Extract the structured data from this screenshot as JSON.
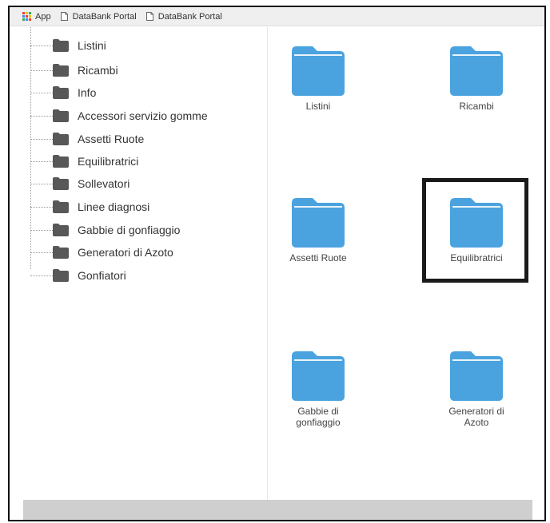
{
  "bookmarks_bar": {
    "apps_label": "App",
    "items": [
      {
        "label": "DataBank Portal"
      },
      {
        "label": "DataBank Portal"
      }
    ],
    "apps_colors": [
      "#ea4335",
      "#fbbc05",
      "#34a853",
      "#4285f4",
      "#ea4335",
      "#fbbc05",
      "#34a853",
      "#4285f4",
      "#ea4335"
    ]
  },
  "tree": {
    "items": [
      {
        "label": "Listini"
      },
      {
        "label": "Ricambi"
      },
      {
        "label": "Info"
      },
      {
        "label": "Accessori servizio gomme"
      },
      {
        "label": "Assetti Ruote"
      },
      {
        "label": "Equilibratrici"
      },
      {
        "label": "Sollevatori"
      },
      {
        "label": "Linee diagnosi"
      },
      {
        "label": "Gabbie di gonfiaggio"
      },
      {
        "label": "Generatori di Azoto"
      },
      {
        "label": "Gonfiatori"
      }
    ]
  },
  "grid": {
    "tiles": [
      {
        "label": "Listini"
      },
      {
        "label": "Ricambi"
      },
      {
        "label": "Assetti Ruote"
      },
      {
        "label": "Equilibratrici",
        "highlighted": true
      },
      {
        "label": "Gabbie di gonfiaggio"
      },
      {
        "label": "Generatori di Azoto"
      }
    ]
  },
  "colors": {
    "folder_blue": "#4aa3df",
    "folder_blue_dark": "#3b8fcf",
    "tree_folder": "#585858",
    "highlight_border": "#1a1a1a"
  }
}
